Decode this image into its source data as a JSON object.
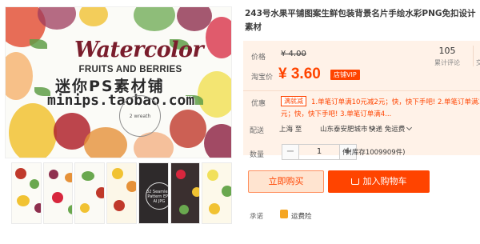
{
  "product": {
    "title_line1": "243号水果平铺图案生鲜包装背景名片手绘水彩PNG免扣设计",
    "title_line2": "素材"
  },
  "image": {
    "title": "Watercolor",
    "subtitle": "FRUITS AND BERRIES",
    "watermark_cn": "迷你PS素材铺",
    "watermark_url": "minips.taobao.com",
    "badge": "2 wreath",
    "thumb_caption": "32 Seamless Pattern EPS AI JPG"
  },
  "price": {
    "label_list": "价格",
    "list_price": "¥ 4.00",
    "label_taobao": "淘宝价",
    "taobao_price": "¥ 3.60",
    "vip_tag": "店铺VIP"
  },
  "stats": {
    "reviews_count": "105",
    "reviews_label": "累计评论",
    "next_label": "交"
  },
  "promo": {
    "label": "优惠",
    "tag": "满就减",
    "text_line1": "1.单笔订单满10元减2元；快，快下手吧! 2.单笔订单满20",
    "text_line2": "元；快，快下手吧! 3.单笔订单满4..."
  },
  "shipping": {
    "label": "配送",
    "origin": "上海 至",
    "destination": "山东泰安肥城市",
    "express": "快递 免运费"
  },
  "quantity": {
    "label": "数量",
    "minus": "−",
    "value": "1",
    "plus": "+",
    "stock": "件(库存1009909件)"
  },
  "actions": {
    "buy_now": "立即购买",
    "add_to_cart": "加入购物车"
  },
  "promise": {
    "label": "承诺",
    "text": "运费险"
  },
  "colors": {
    "accent": "#ff4400",
    "price_bg": "#fff2e8",
    "buy_now_bg": "#ffe4d0"
  }
}
